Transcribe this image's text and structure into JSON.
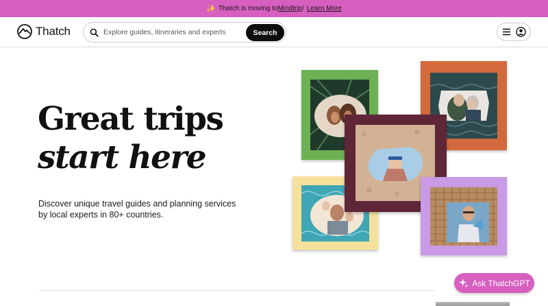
{
  "announcement": {
    "prefix": "Thatch is moving to ",
    "link": "Mindtrip",
    "suffix": "!",
    "cta": "Learn More"
  },
  "header": {
    "logo_text": "Thatch",
    "search": {
      "placeholder": "Explore guides, itineraries and experts",
      "button_label": "Search"
    }
  },
  "hero": {
    "title_line1": "Great trips",
    "title_line2": "start here",
    "subtitle": "Discover unique travel guides and planning services by local experts in 80+ countries."
  },
  "collage": {
    "frames": [
      {
        "name": "green",
        "color": "#6cb153",
        "photo": "friends-in-palm-leaves"
      },
      {
        "name": "orange",
        "color": "#d26a3d",
        "photo": "couple-by-sea"
      },
      {
        "name": "maroon",
        "color": "#5e2637",
        "photo": "woman-on-sand"
      },
      {
        "name": "yellow",
        "color": "#f6e19c",
        "photo": "family-by-water"
      },
      {
        "name": "lilac",
        "color": "#c99ae6",
        "photo": "man-with-wicker"
      }
    ]
  },
  "assistant": {
    "label": "Ask ThatchGPT"
  },
  "colors": {
    "brand_pink": "#d65fbf",
    "search_button": "#0d0d0d"
  }
}
